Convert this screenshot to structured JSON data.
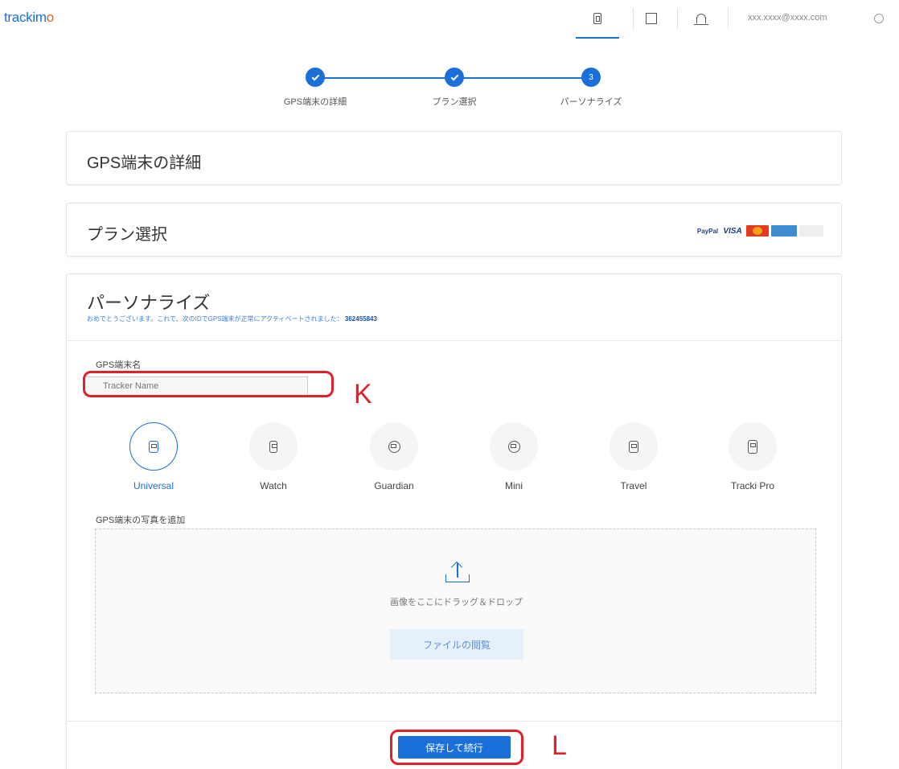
{
  "header": {
    "logo_text": "trackim",
    "logo_accent": "o",
    "email": "xxx.xxxx@xxxx.com",
    "icons": [
      "device-icon",
      "square-icon",
      "bell-icon",
      "user-icon"
    ]
  },
  "stepper": {
    "steps": [
      {
        "label": "GPS端末の詳細",
        "state": "done"
      },
      {
        "label": "プラン選択",
        "state": "done"
      },
      {
        "label": "パーソナライズ",
        "state": "current",
        "number": "3"
      }
    ]
  },
  "cards": {
    "details_title": "GPS端末の詳細",
    "plan_title": "プラン選択",
    "payment_logos": {
      "paypal": "PayPal",
      "visa": "VISA"
    }
  },
  "personalize": {
    "title": "パーソナライズ",
    "note": "おめでとうございます。これで、次のIDでGPS端末が正常にアクティベートされました：",
    "device_id": "362455843",
    "name_label": "GPS端末名",
    "name_placeholder": "Tracker Name",
    "devices": [
      {
        "name": "Universal",
        "selected": true
      },
      {
        "name": "Watch",
        "selected": false
      },
      {
        "name": "Guardian",
        "selected": false
      },
      {
        "name": "Mini",
        "selected": false
      },
      {
        "name": "Travel",
        "selected": false
      },
      {
        "name": "Tracki Pro",
        "selected": false
      }
    ],
    "photo_label": "GPS端末の写真を追加",
    "drop_text": "画像をここにドラッグ＆ドロップ",
    "browse_label": "ファイルの閲覧",
    "save_label": "保存して続行"
  },
  "annotations": {
    "k": "K",
    "l": "L",
    "color": "#e0202a"
  },
  "colors": {
    "accent": "#1a6fd8"
  }
}
